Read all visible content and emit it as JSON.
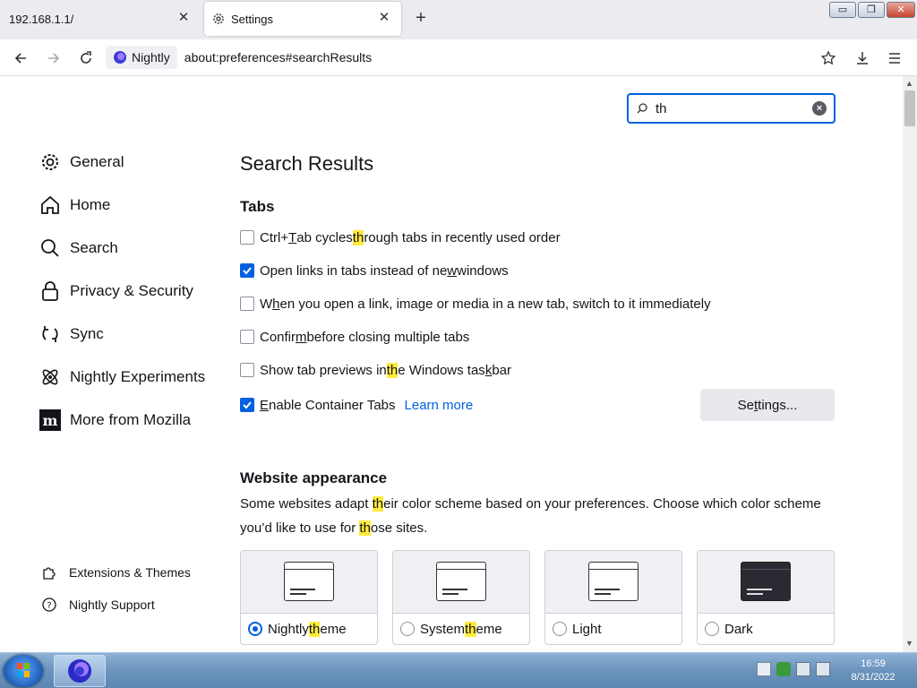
{
  "browser": {
    "tabs": [
      {
        "label": "192.168.1.1/",
        "close": "✕"
      },
      {
        "label": "Settings",
        "close": "✕"
      }
    ],
    "new_tab": "+",
    "window_controls": {
      "minimize": "▭",
      "maximize": "❐",
      "close": "✕"
    },
    "identity_label": "Nightly",
    "url": "about:preferences#searchResults"
  },
  "search": {
    "value": "th"
  },
  "sidebar": {
    "items": [
      {
        "label": "General",
        "icon": "gear-icon"
      },
      {
        "label": "Home",
        "icon": "home-icon"
      },
      {
        "label": "Search",
        "icon": "search-icon"
      },
      {
        "label": "Privacy & Security",
        "icon": "lock-icon"
      },
      {
        "label": "Sync",
        "icon": "sync-icon"
      },
      {
        "label": "Nightly Experiments",
        "icon": "experiments-icon"
      },
      {
        "label": "More from Mozilla",
        "icon": "mozilla-icon"
      }
    ],
    "footer": [
      {
        "label": "Extensions & Themes",
        "icon": "puzzle-icon"
      },
      {
        "label": "Nightly Support",
        "icon": "help-icon"
      }
    ]
  },
  "main": {
    "title": "Search Results",
    "tabs_heading": "Tabs",
    "options": [
      {
        "pre": "Ctrl+",
        "u": "T",
        "mid": "ab cycles ",
        "hl": "th",
        "post": "rough tabs in recently used order",
        "checked": false
      },
      {
        "pre": "Open links in tabs instead of ne",
        "u": "w",
        "post": " windows",
        "checked": true
      },
      {
        "pre": "W",
        "u": "h",
        "post": "en you open a link, image or media in a new tab, switch to it immediately",
        "checked": false
      },
      {
        "pre": "Confir",
        "u": "m",
        "post": " before closing multiple tabs",
        "checked": false
      },
      {
        "pre": "Show tab previews in ",
        "hl": "th",
        "mid": "e Windows tas",
        "u": "k",
        "post": "bar",
        "checked": false
      },
      {
        "pre": "",
        "u": "E",
        "post": "nable Container Tabs",
        "checked": true
      }
    ],
    "learn_more": "Learn more",
    "settings_button": {
      "pre": "Se",
      "u": "t",
      "post": "tings..."
    },
    "appearance_heading": "Website appearance",
    "appearance_desc": {
      "p1": "Some websites adapt ",
      "hl1": "th",
      "p2": "eir color scheme based on your preferences. Choose which color scheme you’d like to use for ",
      "hl2": "th",
      "p3": "ose sites."
    },
    "themes": [
      {
        "pre": "Nightly ",
        "hl": "th",
        "post": "eme",
        "selected": true,
        "dark": false
      },
      {
        "pre": "System ",
        "hl": "th",
        "post": "eme",
        "selected": false,
        "dark": false
      },
      {
        "pre": "Light",
        "hl": "",
        "post": "",
        "selected": false,
        "dark": false
      },
      {
        "pre": "Dark",
        "hl": "",
        "post": "",
        "selected": false,
        "dark": true
      }
    ]
  },
  "taskbar": {
    "time": "16:59",
    "date": "8/31/2022"
  },
  "colors": {
    "accent": "#0061e0",
    "highlight": "#ffeb3b"
  }
}
